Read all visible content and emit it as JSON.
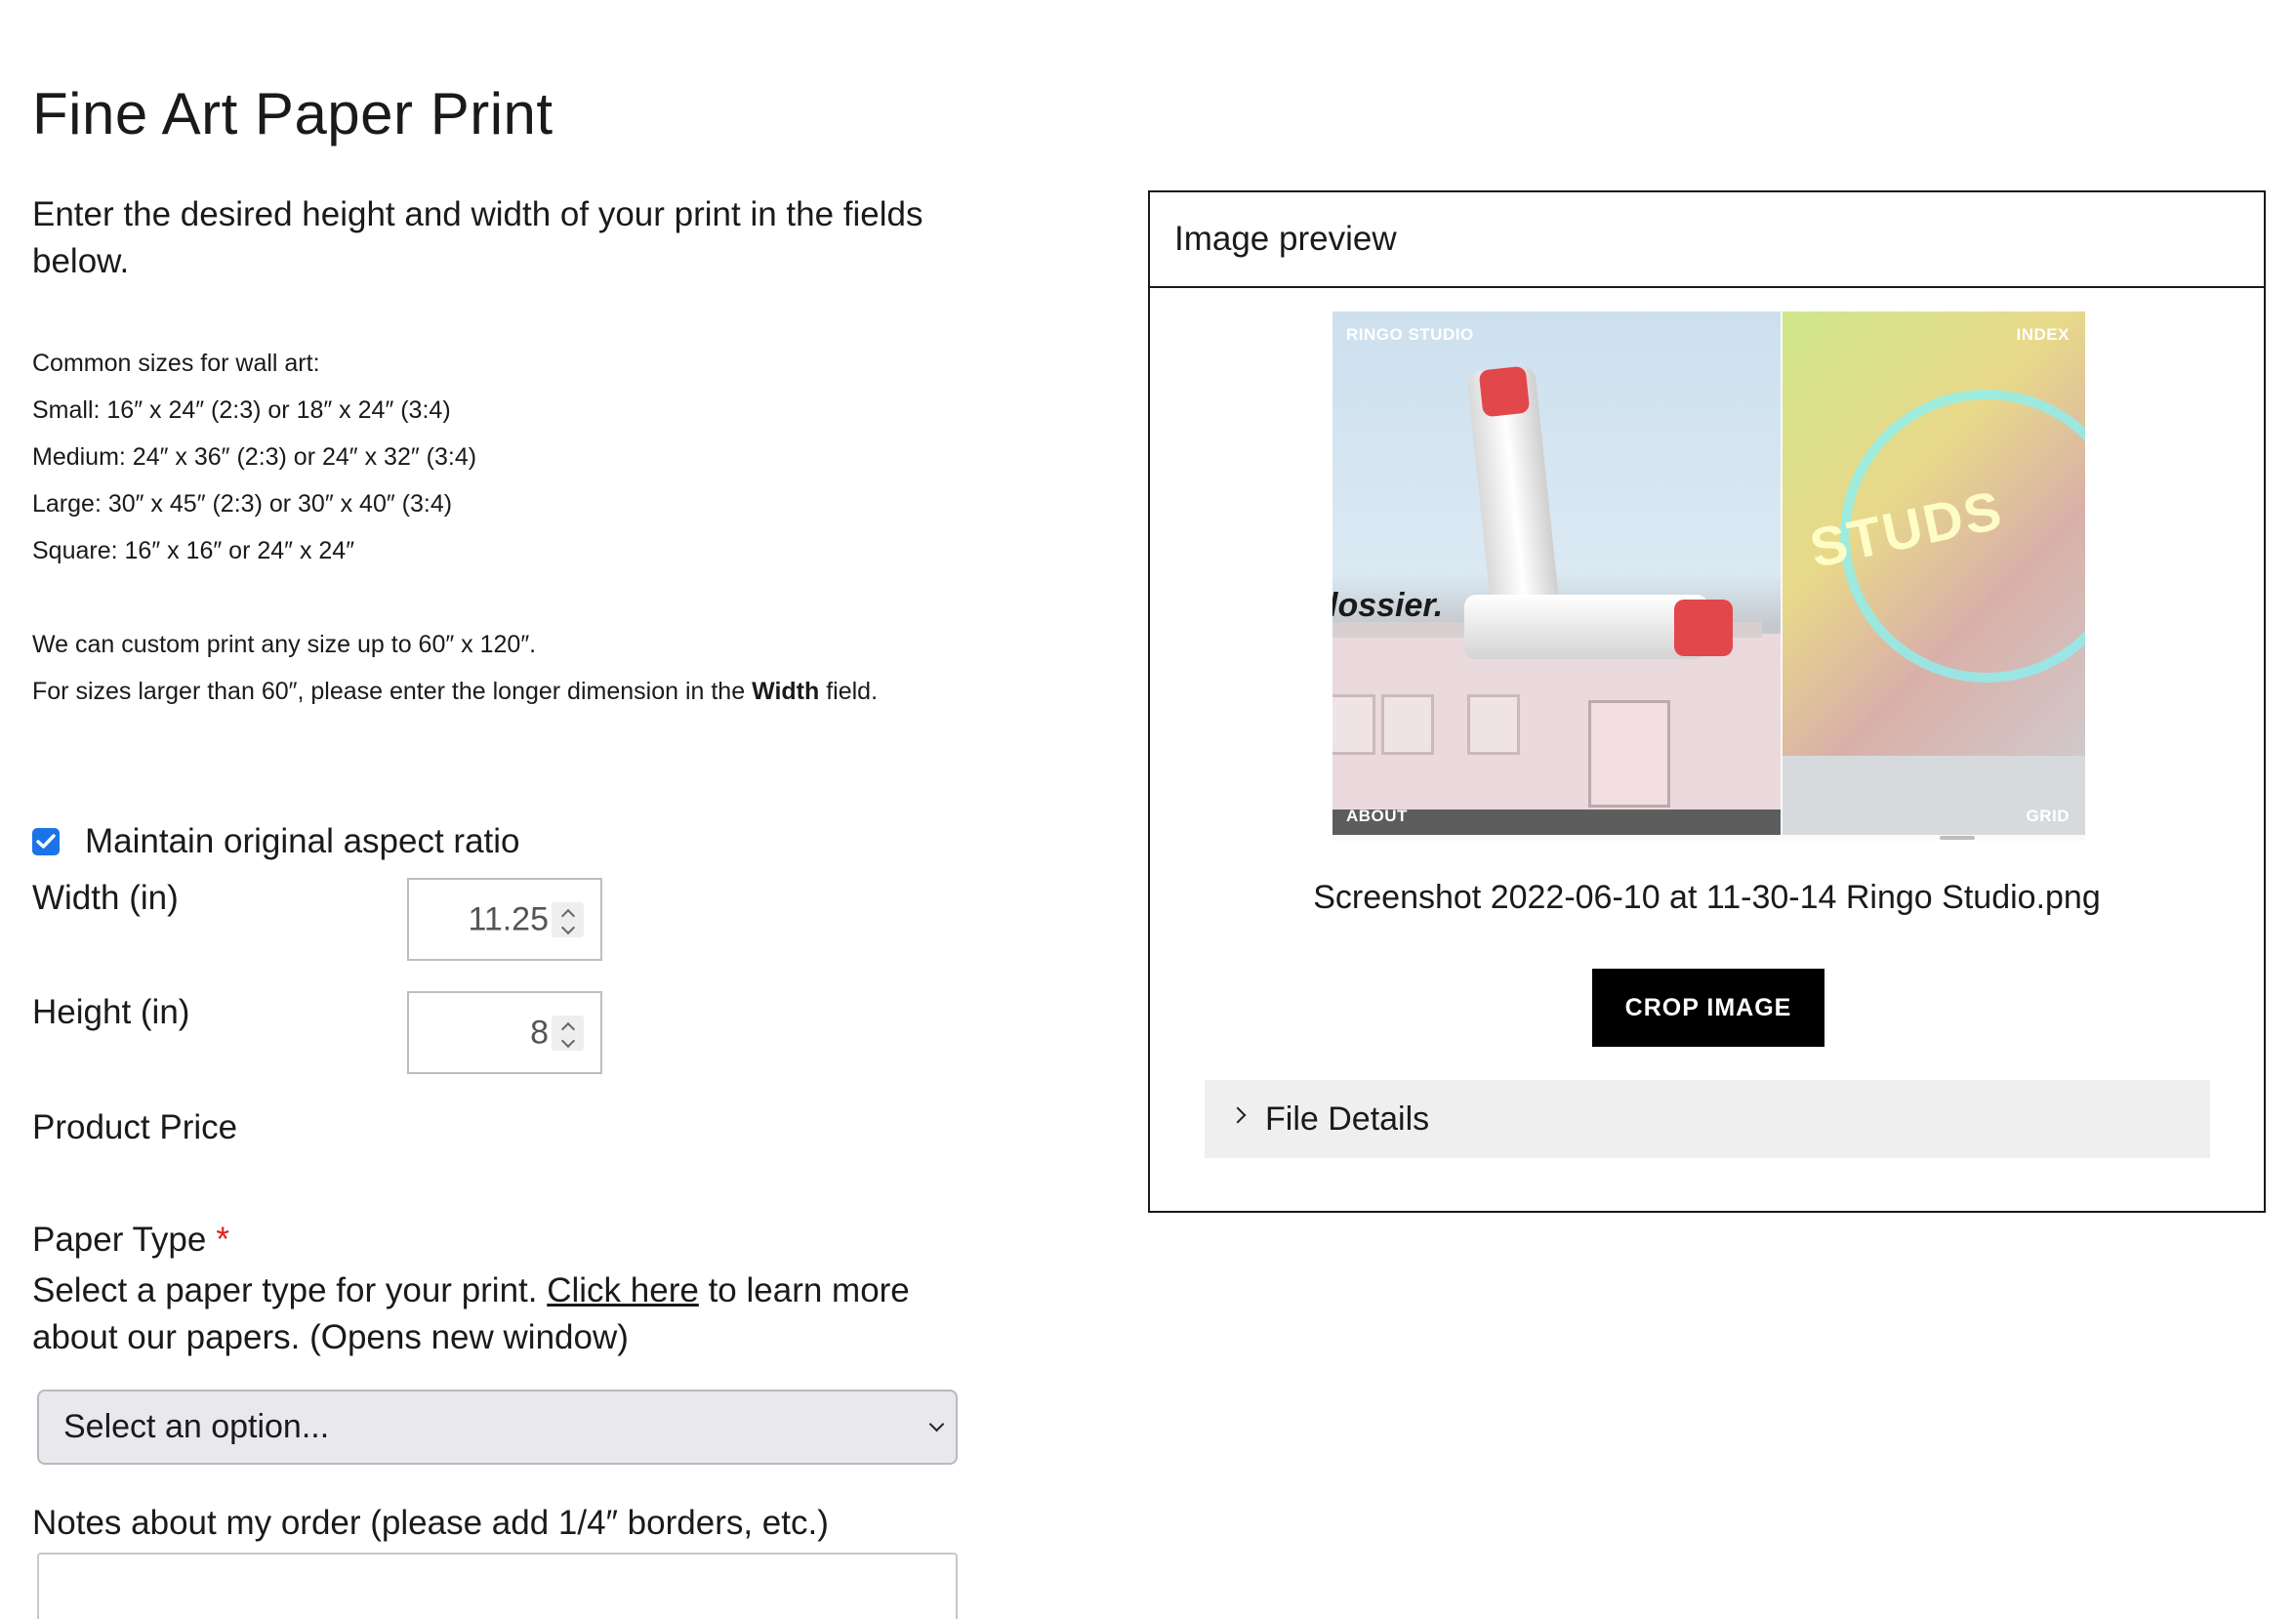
{
  "product": {
    "title": "Fine Art Paper Print",
    "intro": "Enter the desired height and width of your print in the fields below."
  },
  "sizes": {
    "heading": "Common sizes for wall art:",
    "lines": [
      "Small: 16″ x 24″ (2:3) or 18″ x 24″ (3:4)",
      "Medium: 24″ x 36″ (2:3) or 24″ x 32″ (3:4)",
      "Large: 30″ x 45″ (2:3) or 30″ x 40″ (3:4)",
      "Square: 16″ x 16″ or 24″ x 24″"
    ]
  },
  "custom": {
    "line1": "We can custom print any size up to 60″ x 120″.",
    "line2_pre": "For sizes larger than 60″, please enter the longer dimension in the ",
    "line2_bold": "Width",
    "line2_post": " field."
  },
  "aspect": {
    "label": "Maintain original aspect ratio",
    "checked": true,
    "color": "#1a73e8"
  },
  "width": {
    "label": "Width (in)",
    "value": "11.25"
  },
  "height": {
    "label": "Height (in)",
    "value": "8"
  },
  "price": {
    "label": "Product Price"
  },
  "paper": {
    "label": "Paper Type",
    "required_mark": "*",
    "help_pre": "Select a paper type for your print. ",
    "help_link": "Click here",
    "help_post": " to learn more about our papers. (Opens new window)",
    "select_value": "Select an option..."
  },
  "notes": {
    "label": "Notes about my order (please add 1/4″ borders, etc.)",
    "value": ""
  },
  "preview": {
    "header": "Image preview",
    "thumb": {
      "tl": "RINGO STUDIO",
      "tr": "INDEX",
      "bl": "ABOUT",
      "br": "GRID",
      "sign": "lossier.",
      "neon": "STUDS"
    },
    "filename": "Screenshot 2022-06-10 at 11-30-14 Ringo Studio.png",
    "crop_label": "CROP IMAGE",
    "details_label": "File Details"
  }
}
